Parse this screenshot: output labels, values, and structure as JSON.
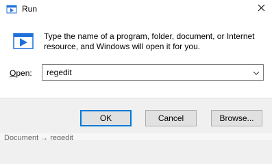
{
  "window": {
    "title": "Run",
    "icon": "run-app-icon",
    "close_icon": "close-icon"
  },
  "content": {
    "description": "Type the name of a program, folder, document, or Internet resource, and Windows will open it for you.",
    "icon": "run-program-icon"
  },
  "open": {
    "label_accel": "O",
    "label_rest": "pen:",
    "value": "regedit",
    "dropdown_icon": "chevron-down-icon"
  },
  "buttons": {
    "ok": "OK",
    "cancel": "Cancel",
    "browse": "Browse..."
  },
  "backdrop": {
    "text": "Document → regedit"
  },
  "colors": {
    "accent": "#0078d7",
    "bottom_bar": "#f0f0f0",
    "button_face": "#e1e1e1"
  }
}
